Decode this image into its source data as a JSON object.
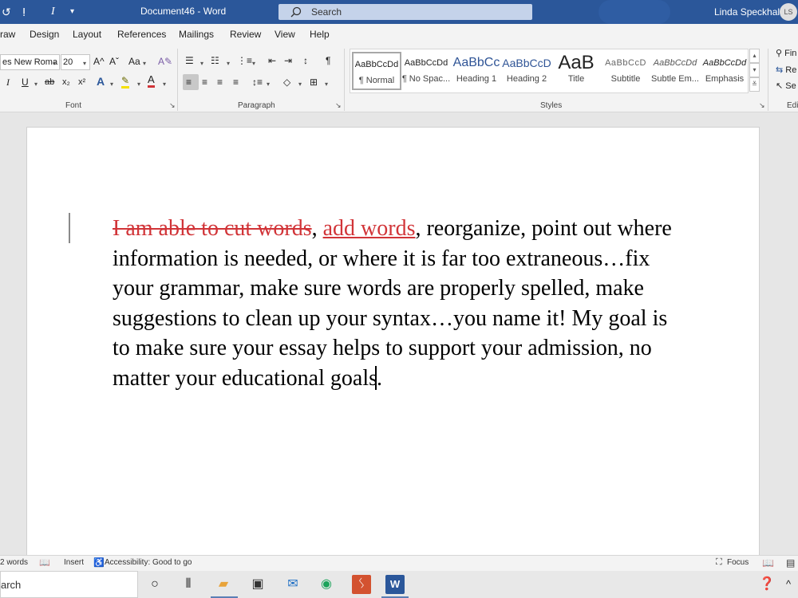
{
  "titlebar": {
    "doc_title": "Document46 - Word",
    "search_placeholder": "Search",
    "user_name": "Linda Speckhals",
    "user_initials": "LS"
  },
  "tabs": [
    "raw",
    "Design",
    "Layout",
    "References",
    "Mailings",
    "Review",
    "View",
    "Help"
  ],
  "ribbon": {
    "font_name": "es New Roma",
    "font_size": "20",
    "font_group_label": "Font",
    "paragraph_group_label": "Paragraph",
    "styles_group_label": "Styles",
    "editing_group_label": "Edi",
    "editing_items": [
      "Fin",
      "Re",
      "Se"
    ],
    "grow_font": "A^",
    "shrink_font": "Aˇ",
    "change_case": "Aa",
    "italic": "I",
    "underline": "U",
    "strike": "ab",
    "subscript": "x₂",
    "superscript": "x²",
    "highlight": "✎",
    "font_color": "A",
    "text_effects": "A",
    "styles": [
      {
        "preview": "AaBbCcDd",
        "name": "¶ Normal"
      },
      {
        "preview": "AaBbCcDd",
        "name": "¶ No Spac..."
      },
      {
        "preview": "AaBbCc",
        "name": "Heading 1"
      },
      {
        "preview": "AaBbCcD",
        "name": "Heading 2"
      },
      {
        "preview": "AaB",
        "name": "Title"
      },
      {
        "preview": "AaBbCcD",
        "name": "Subtitle"
      },
      {
        "preview": "AaBbCcDd",
        "name": "Subtle Em..."
      },
      {
        "preview": "AaBbCcDd",
        "name": "Emphasis"
      }
    ]
  },
  "document": {
    "deleted_text": "I am able to cut words",
    "comma1": ", ",
    "inserted_text": "add words",
    "body_text": ", reorganize, point out where information is needed, or where it is far too extraneous…fix your grammar, make sure words are properly spelled, make suggestions to clean up your syntax…you name it!  My goal is to make sure your essay helps to support your admission, no matter your educational goals",
    "end_char": "."
  },
  "statusbar": {
    "word_count": "2 words",
    "mode": "Insert",
    "accessibility": "Accessibility: Good to go",
    "focus": "Focus"
  },
  "taskbar": {
    "search_text": "arch"
  },
  "colors": {
    "accent": "#2b579a",
    "revision": "#d13438"
  }
}
